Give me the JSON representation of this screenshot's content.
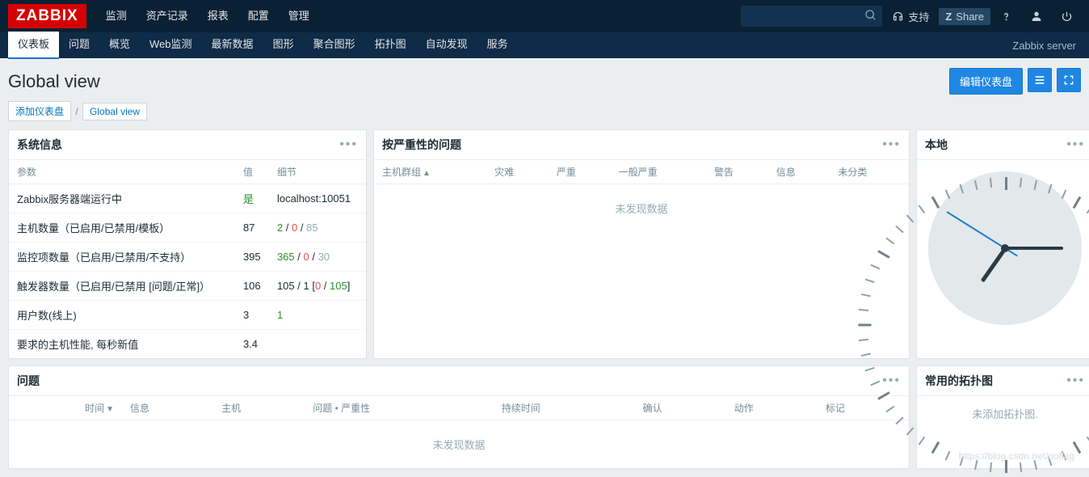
{
  "logo": "ZABBIX",
  "topMenu": [
    "监测",
    "资产记录",
    "报表",
    "配置",
    "管理"
  ],
  "topActive": 0,
  "search": {
    "placeholder": ""
  },
  "support": "支持",
  "share": "Share",
  "subMenu": [
    "仪表板",
    "问题",
    "概览",
    "Web监测",
    "最新数据",
    "图形",
    "聚合图形",
    "拓扑图",
    "自动发现",
    "服务"
  ],
  "subActive": 0,
  "serverLabel": "Zabbix server",
  "pageTitle": "Global view",
  "editBtn": "编辑仪表盘",
  "breadcrumbs": {
    "add": "添加仪表盘",
    "current": "Global view"
  },
  "sysInfo": {
    "title": "系统信息",
    "headers": [
      "参数",
      "值",
      "细节"
    ],
    "rows": [
      {
        "param": "Zabbix服务器端运行中",
        "value": {
          "text": "是",
          "cls": "val-green"
        },
        "detail": [
          {
            "text": "localhost:10051",
            "cls": ""
          }
        ]
      },
      {
        "param": "主机数量（已启用/已禁用/模板）",
        "value": {
          "text": "87",
          "cls": ""
        },
        "detail": [
          {
            "text": "2",
            "cls": "val-green"
          },
          {
            "text": " / ",
            "cls": ""
          },
          {
            "text": "0",
            "cls": "val-red"
          },
          {
            "text": " / ",
            "cls": ""
          },
          {
            "text": "85",
            "cls": "val-grey"
          }
        ]
      },
      {
        "param": "监控项数量（已启用/已禁用/不支持）",
        "value": {
          "text": "395",
          "cls": ""
        },
        "detail": [
          {
            "text": "365",
            "cls": "val-green"
          },
          {
            "text": " / ",
            "cls": ""
          },
          {
            "text": "0",
            "cls": "val-red"
          },
          {
            "text": " / ",
            "cls": ""
          },
          {
            "text": "30",
            "cls": "val-grey"
          }
        ]
      },
      {
        "param": "触发器数量（已启用/已禁用 [问题/正常]）",
        "value": {
          "text": "106",
          "cls": ""
        },
        "detail": [
          {
            "text": "105 / 1 [",
            "cls": ""
          },
          {
            "text": "0",
            "cls": "val-red"
          },
          {
            "text": " / ",
            "cls": ""
          },
          {
            "text": "105",
            "cls": "val-green"
          },
          {
            "text": "]",
            "cls": ""
          }
        ]
      },
      {
        "param": "用户数(线上)",
        "value": {
          "text": "3",
          "cls": ""
        },
        "detail": [
          {
            "text": "1",
            "cls": "val-green"
          }
        ]
      },
      {
        "param": "要求的主机性能, 每秒新值",
        "value": {
          "text": "3.4",
          "cls": ""
        },
        "detail": []
      }
    ]
  },
  "severity": {
    "title": "按严重性的问题",
    "headers": [
      "主机群组",
      "灾难",
      "严重",
      "一般严重",
      "警告",
      "信息",
      "未分类"
    ],
    "nodata": "未发现数据"
  },
  "local": {
    "title": "本地"
  },
  "problems": {
    "title": "问题",
    "headers": [
      "时间",
      "信息",
      "主机",
      "问题 • 严重性",
      "持续时间",
      "确认",
      "动作",
      "标记"
    ],
    "nodata": "未发现数据"
  },
  "favMap": {
    "title": "常用的拓扑图",
    "empty": "未添加拓扑图."
  },
  "watermark": "https://blog.csdn.net/noflag"
}
